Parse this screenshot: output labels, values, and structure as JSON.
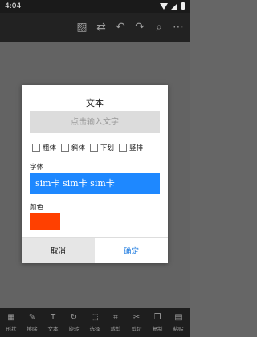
{
  "status_bar": {
    "time": "4:04"
  },
  "toolbar": {
    "buttons": [
      {
        "icon": "image-icon",
        "glyph": "▨"
      },
      {
        "icon": "swap-icon",
        "glyph": "⇄"
      },
      {
        "icon": "undo-icon",
        "glyph": "↶"
      },
      {
        "icon": "redo-icon",
        "glyph": "↷"
      },
      {
        "icon": "zoom-icon",
        "glyph": "⌕"
      },
      {
        "icon": "more-icon",
        "glyph": "⋯"
      }
    ]
  },
  "dialog": {
    "title": "文本",
    "input": {
      "value": "",
      "placeholder": "点击输入文字"
    },
    "style_options": [
      "粗体",
      "斜体",
      "下划",
      "竖排"
    ],
    "font_label": "字体",
    "font_preview": "sim卡 sim卡 sim卡",
    "color_label": "颜色",
    "selected_color": "#ff4000",
    "cancel_label": "取消",
    "ok_label": "确定"
  },
  "bottom_bar": {
    "items": [
      {
        "label": "形状",
        "glyph": "▦"
      },
      {
        "label": "擦除",
        "glyph": "✎"
      },
      {
        "label": "文本",
        "glyph": "T"
      },
      {
        "label": "旋转",
        "glyph": "↻"
      },
      {
        "label": "选择",
        "glyph": "⬚"
      },
      {
        "label": "裁剪",
        "glyph": "⌗"
      },
      {
        "label": "剪切",
        "glyph": "✂"
      },
      {
        "label": "复制",
        "glyph": "❐"
      },
      {
        "label": "粘贴",
        "glyph": "▤"
      }
    ]
  }
}
